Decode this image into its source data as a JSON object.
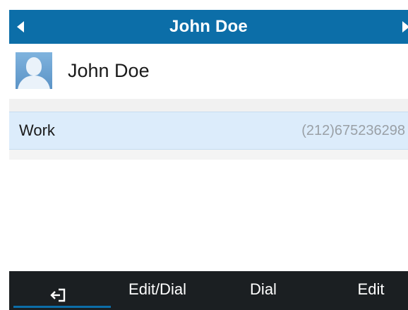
{
  "titlebar": {
    "title": "John Doe",
    "left_arrow_icon": "arrow-left-icon",
    "right_arrow_icon": "arrow-right-icon"
  },
  "contact": {
    "name": "John Doe",
    "avatar_icon": "person-avatar-icon"
  },
  "numbers": [
    {
      "label": "Work",
      "value": "(212)675236298",
      "selected": true
    }
  ],
  "softkeys": {
    "back_icon": "exit-icon",
    "edit_dial_label": "Edit/Dial",
    "dial_label": "Dial",
    "edit_label": "Edit"
  },
  "colors": {
    "titlebar_bg": "#0c6ea8",
    "selected_row_bg": "#dcecfb",
    "softkey_bg": "#1b1f22",
    "number_text": "#9aa0a6"
  }
}
